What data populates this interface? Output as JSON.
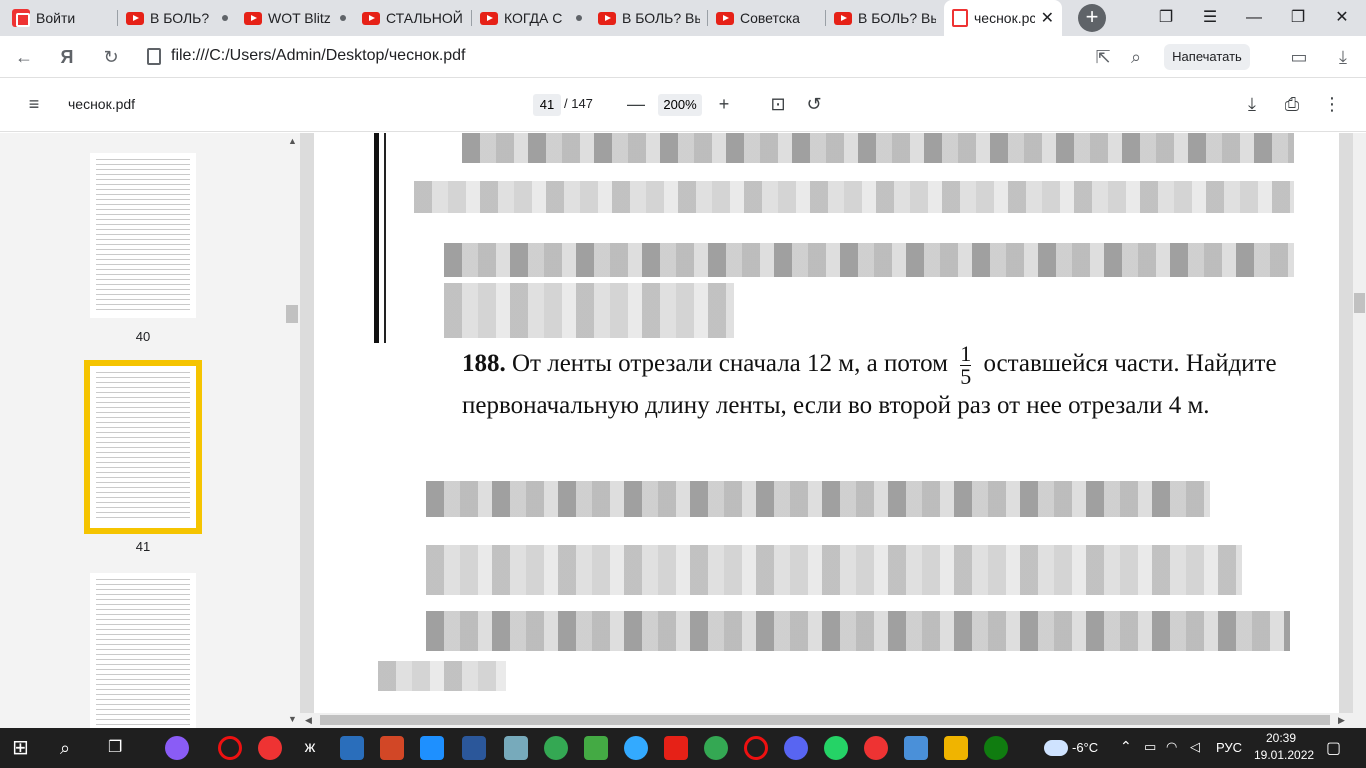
{
  "tabs": [
    {
      "label": "Войти",
      "icon": "login-icon"
    },
    {
      "label": "В БОЛЬ?",
      "icon": "youtube-icon"
    },
    {
      "label": "WOT Blitz",
      "icon": "youtube-icon"
    },
    {
      "label": "СТАЛЬНОЙ",
      "icon": "youtube-icon"
    },
    {
      "label": "КОГДА С",
      "icon": "youtube-icon"
    },
    {
      "label": "В БОЛЬ? Вы",
      "icon": "youtube-icon"
    },
    {
      "label": "Советска",
      "icon": "youtube-icon"
    },
    {
      "label": "В БОЛЬ? Вы",
      "icon": "youtube-icon"
    },
    {
      "label": "чеснок.pc",
      "icon": "pdf-icon",
      "active": true
    }
  ],
  "address": {
    "url": "file:///C:/Users/Admin/Desktop/чеснок.pdf",
    "print_label": "Напечатать"
  },
  "pdf_toolbar": {
    "doc_name": "чеснок.pdf",
    "current_page": "41",
    "total_pages": "/ 147",
    "zoom": "200%"
  },
  "thumbnails": [
    {
      "label": "40"
    },
    {
      "label": "41",
      "selected": true
    }
  ],
  "problem": {
    "number": "188.",
    "text_before_fraction": " От ленты отрезали сначала 12 м, а потом",
    "fraction_num": "1",
    "fraction_den": "5",
    "text_after_fraction": " оставшейся части. Найдите первоначальную длину ленты, если во второй раз от нее отрезали 4 м."
  },
  "taskbar": {
    "weather": "-6°C",
    "language": "РУС",
    "time": "20:39",
    "date": "19.01.2022"
  },
  "colors": {
    "thumb_highlight": "#f5c400",
    "tab_strip": "#dfe1e5",
    "taskbar": "#1f1f1f"
  }
}
